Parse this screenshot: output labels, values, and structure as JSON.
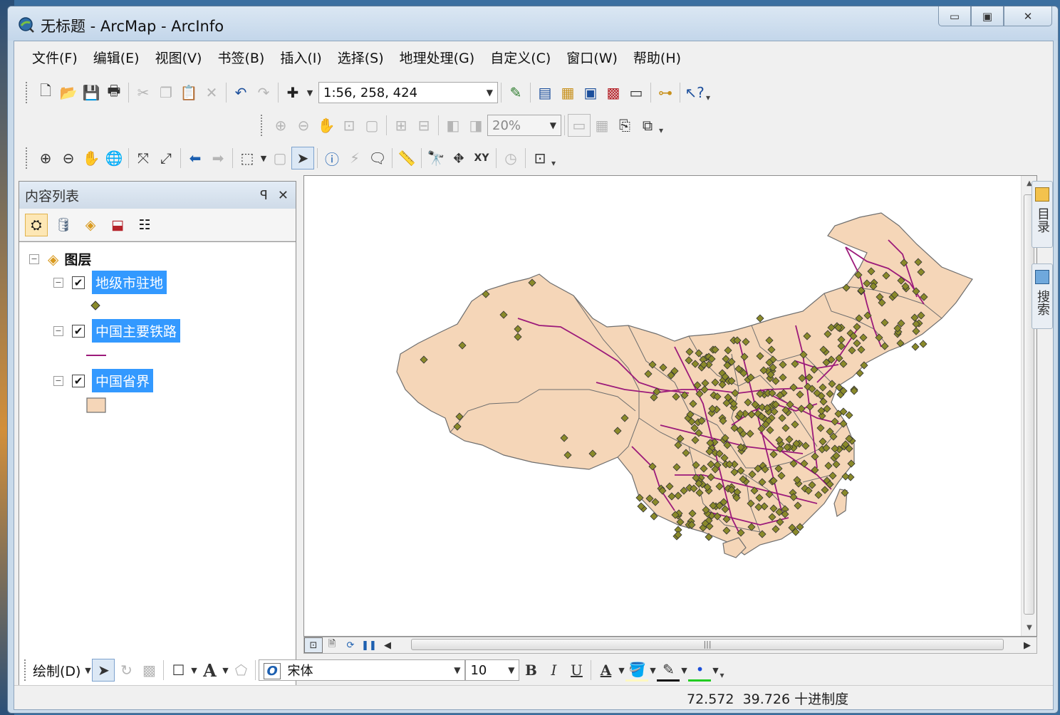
{
  "window": {
    "title": "无标题 - ArcMap - ArcInfo",
    "controls": {
      "minimize": "▭",
      "maximize": "▣",
      "close": "✕"
    }
  },
  "menubar": {
    "items": [
      "文件(F)",
      "编辑(E)",
      "视图(V)",
      "书签(B)",
      "插入(I)",
      "选择(S)",
      "地理处理(G)",
      "自定义(C)",
      "窗口(W)",
      "帮助(H)"
    ]
  },
  "standard_toolbar": {
    "scale": "1:56, 258, 424",
    "icons": [
      "new-document",
      "open",
      "save",
      "print",
      "cut",
      "copy",
      "paste",
      "delete",
      "undo",
      "redo",
      "add-data",
      "editor-toolbar",
      "table-of-contents-window",
      "catalog-window",
      "search-window",
      "arctoolbox",
      "python",
      "model-builder",
      "whats-this"
    ]
  },
  "layout_toolbar": {
    "zoom_percent": "20%"
  },
  "tools_toolbar": {
    "icons": [
      "zoom-in",
      "zoom-out",
      "pan",
      "full-extent",
      "fixed-zoom-in",
      "fixed-zoom-out",
      "back",
      "forward",
      "select-features",
      "clear-selection",
      "select-elements",
      "identify",
      "hyperlink",
      "html-popup",
      "measure",
      "find",
      "find-route",
      "go-to-xy",
      "time-slider",
      "create-viewer-window"
    ]
  },
  "toc": {
    "title": "内容列表",
    "pin_glyph": "ꟼ",
    "close_glyph": "✕",
    "root_label": "图层",
    "layers": [
      {
        "label": "地级市驻地",
        "checked": "✔",
        "symbol": "point"
      },
      {
        "label": "中国主要铁路",
        "checked": "✔",
        "symbol": "line"
      },
      {
        "label": "中国省界",
        "checked": "✔",
        "symbol": "polygon"
      }
    ]
  },
  "side_tabs": {
    "catalog": "目录",
    "search": "搜索"
  },
  "map": {
    "colors": {
      "province_fill": "#f5d6b8",
      "province_border": "#6e6e6e",
      "railway": "#9c1a7a",
      "city_point": "#8a8a2a"
    }
  },
  "drawing_toolbar": {
    "draw_label": "绘制(D)",
    "font_name": "宋体",
    "font_size": "10",
    "bold": "B",
    "italic": "I",
    "underline": "U",
    "text_tool": "A"
  },
  "statusbar": {
    "x": "72.572",
    "y": "39.726",
    "units": "十进制度"
  }
}
